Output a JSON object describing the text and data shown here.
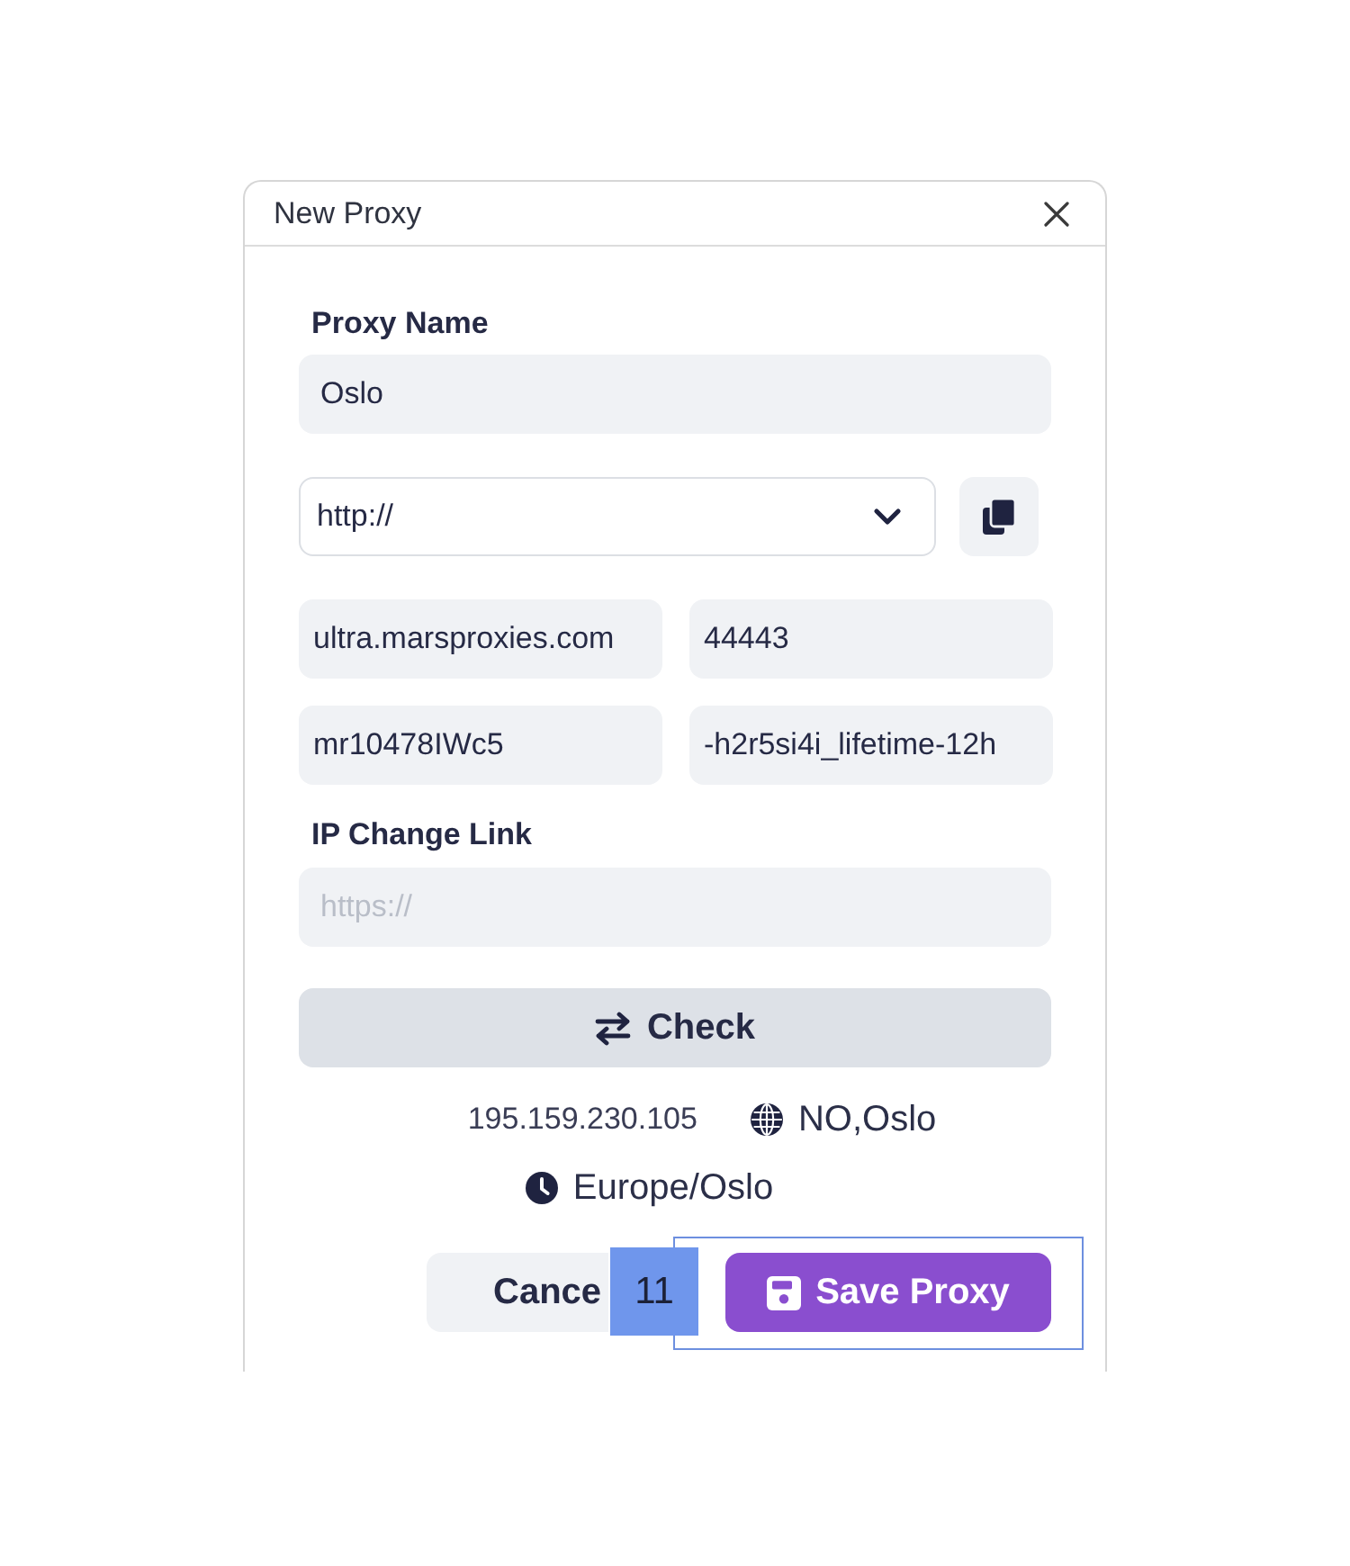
{
  "dialog": {
    "title": "New Proxy"
  },
  "proxy_name": {
    "label": "Proxy Name",
    "value": "Oslo"
  },
  "protocol": {
    "value": "http://"
  },
  "connection_fields": [
    {
      "value": "ultra.marsproxies.com"
    },
    {
      "value": "44443"
    },
    {
      "value": "mr10478IWc5"
    },
    {
      "value": "-h2r5si4i_lifetime-12h"
    }
  ],
  "ip_change_link": {
    "label": "IP Change Link",
    "placeholder": "https://"
  },
  "check_button": {
    "label": "Check"
  },
  "result": {
    "ip": "195.159.230.105",
    "location": "NO,Oslo",
    "timezone": "Europe/Oslo"
  },
  "buttons": [
    {
      "label": "Cance",
      "kind": "secondary"
    },
    {
      "label": "Save Proxy",
      "kind": "primary"
    }
  ],
  "annotation": {
    "label": "11"
  }
}
